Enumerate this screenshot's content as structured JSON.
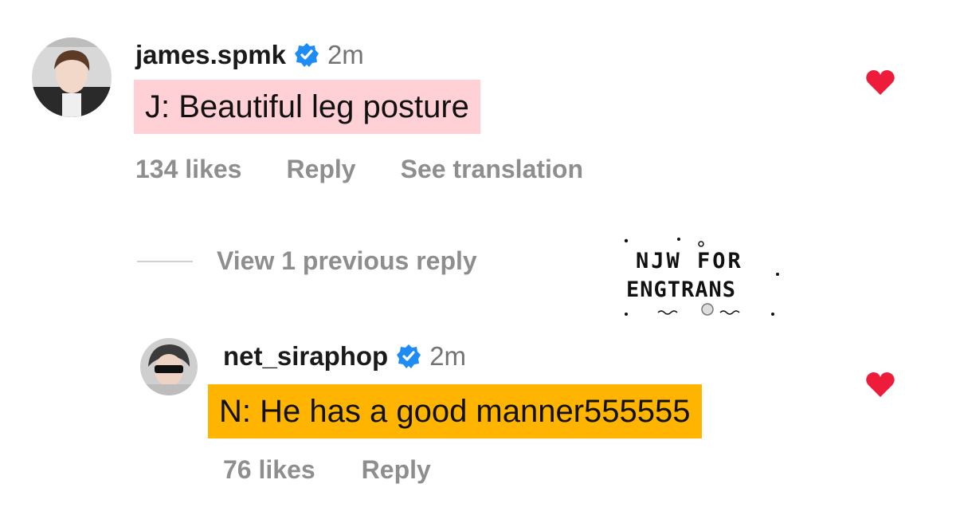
{
  "comments": [
    {
      "username": "james.spmk",
      "time": "2m",
      "text": "J: Beautiful leg posture",
      "likes": "134 likes",
      "reply": "Reply",
      "translation": "See translation",
      "highlight_color": "#ffd0d6"
    },
    {
      "username": "net_siraphop",
      "time": "2m",
      "text": "N: He has a good manner555555",
      "likes": "76 likes",
      "reply": "Reply",
      "highlight_color": "#ffb400"
    }
  ],
  "view_replies": "View 1 previous reply",
  "watermark": {
    "line1": "NJW FOR",
    "line2": "ENGTRANS"
  },
  "colors": {
    "verified": "#1f8cf5",
    "heart": "#ed1c3a",
    "muted": "#8e8e8e"
  },
  "icons": [
    "avatar",
    "verified-badge-icon",
    "heart-icon"
  ]
}
